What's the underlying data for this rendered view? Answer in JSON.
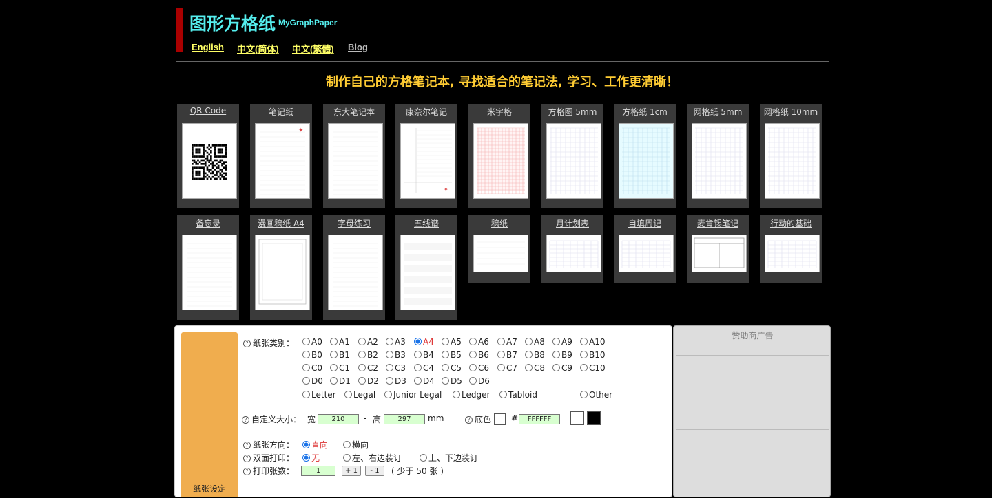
{
  "header": {
    "title": "图形方格纸",
    "subtitle": "MyGraphPaper",
    "langs": [
      {
        "label": "English",
        "color": "#ffff66"
      },
      {
        "label": "中文(简体)",
        "color": "#ffff66"
      },
      {
        "label": "中文(繁體)",
        "color": "#ffff66"
      },
      {
        "label": "Blog",
        "color": "#bbbbbb"
      }
    ],
    "colors": {
      "title": "#55eeee",
      "bar": "#aa0000"
    }
  },
  "slogan": "制作自己的方格笔记本, 寻找适合的笔记法, 学习、工作更清晰！",
  "templates": [
    {
      "label": "QR Code",
      "icon": "qr-code-icon"
    },
    {
      "label": "笔记纸",
      "icon": "lined-paper-icon"
    },
    {
      "label": "东大笔记本",
      "icon": "lined-paper-icon"
    },
    {
      "label": "康奈尔笔记",
      "icon": "cornell-notes-icon"
    },
    {
      "label": "米字格",
      "icon": "grid-paper-icon"
    },
    {
      "label": "方格图 5mm",
      "icon": "grid-paper-icon"
    },
    {
      "label": "方格纸 1cm",
      "icon": "grid-paper-icon"
    },
    {
      "label": "网格纸 5mm",
      "icon": "grid-paper-icon"
    },
    {
      "label": "网格纸 10mm",
      "icon": "grid-paper-icon"
    },
    {
      "label": "备忘录",
      "icon": "memo-paper-icon"
    },
    {
      "label": "漫画稿纸 A4",
      "icon": "manga-paper-icon"
    },
    {
      "label": "字母练习",
      "icon": "lined-paper-icon"
    },
    {
      "label": "五线谱",
      "icon": "staff-paper-icon"
    },
    {
      "label": "稿纸",
      "icon": "manuscript-paper-icon"
    },
    {
      "label": "月计划表",
      "icon": "calendar-paper-icon"
    },
    {
      "label": "自填周记",
      "icon": "weekly-paper-icon"
    },
    {
      "label": "麦肯锡笔记",
      "icon": "mckinsey-notes-icon"
    },
    {
      "label": "行动的基础",
      "icon": "action-notes-icon"
    }
  ],
  "settings": {
    "tab_label": "纸张设定",
    "paper_type": {
      "label": "纸张类别：",
      "rows": [
        [
          "A0",
          "A1",
          "A2",
          "A3",
          "A4",
          "A5",
          "A6",
          "A7",
          "A8",
          "A9",
          "A10"
        ],
        [
          "B0",
          "B1",
          "B2",
          "B3",
          "B4",
          "B5",
          "B6",
          "B7",
          "B8",
          "B9",
          "B10"
        ],
        [
          "C0",
          "C1",
          "C2",
          "C3",
          "C4",
          "C5",
          "C6",
          "C7",
          "C8",
          "C9",
          "C10"
        ],
        [
          "D0",
          "D1",
          "D2",
          "D3",
          "D4",
          "D5",
          "D6"
        ]
      ],
      "named": [
        "Letter",
        "Legal",
        "Junior Legal",
        "Ledger",
        "Tabloid",
        "Other"
      ],
      "selected": "A4"
    },
    "custom_size": {
      "label": "自定义大小：",
      "width_label": "宽",
      "width": "210",
      "dash": "-",
      "height_label": "高",
      "height": "297",
      "unit": "mm",
      "bg_label": "底色",
      "hash": "#",
      "bg_value": "FFFFFF",
      "swatch_light": "#ffffff",
      "swatch_dark": "#000000"
    },
    "orientation": {
      "label": "纸张方向：",
      "options": [
        "直向",
        "横向"
      ],
      "selected": "直向"
    },
    "duplex": {
      "label": "双面打印：",
      "options": [
        "无",
        "左、右边装订",
        "上、下边装订"
      ],
      "selected": "无"
    },
    "copies": {
      "label": "打印张数：",
      "value": "1",
      "plus": "+ 1",
      "minus": "- 1",
      "note": "( 少于 50 张 )"
    }
  },
  "ad": {
    "title": "赞助商广告"
  },
  "colors": {
    "accent_tab": "#f0ad4e",
    "slogan": "#ffcc33",
    "input_bg": "#d8ffd0"
  }
}
